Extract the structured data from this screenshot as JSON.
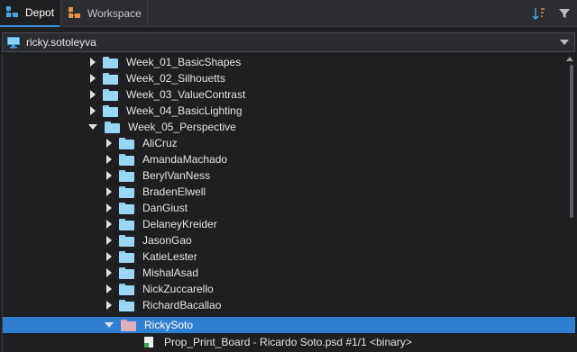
{
  "tabs": [
    {
      "label": "Depot",
      "active": true
    },
    {
      "label": "Workspace",
      "active": false
    }
  ],
  "toolbar": {
    "sort_icon": "sort-icon",
    "filter_icon": "filter-icon"
  },
  "workspace": {
    "name": "ricky.sotoleyva",
    "icon": "computer-icon"
  },
  "tree": {
    "top_folders": [
      {
        "label": "Week_01_BasicShapes",
        "expanded": false
      },
      {
        "label": "Week_02_Silhouetts",
        "expanded": false
      },
      {
        "label": "Week_03_ValueContrast",
        "expanded": false
      },
      {
        "label": "Week_04_BasicLighting",
        "expanded": false
      },
      {
        "label": "Week_05_Perspective",
        "expanded": true
      }
    ],
    "sub_folders": [
      {
        "label": "AliCruz"
      },
      {
        "label": "AmandaMachado"
      },
      {
        "label": "BerylVanNess"
      },
      {
        "label": "BradenElwell"
      },
      {
        "label": "DanGiust"
      },
      {
        "label": "DelaneyKreider"
      },
      {
        "label": "JasonGao"
      },
      {
        "label": "KatieLester"
      },
      {
        "label": "MishalAsad"
      },
      {
        "label": "NickZuccarello"
      },
      {
        "label": "RichardBacallao"
      },
      {
        "label": "RickySoto",
        "selected": true,
        "expanded": true
      }
    ],
    "file": {
      "label": "Prop_Print_Board - Ricardo Soto.psd #1/1 <binary>"
    }
  },
  "colors": {
    "selection": "#2f7fd0",
    "folder": "#9ad7f2",
    "selected_folder": "#dcb0bb"
  }
}
